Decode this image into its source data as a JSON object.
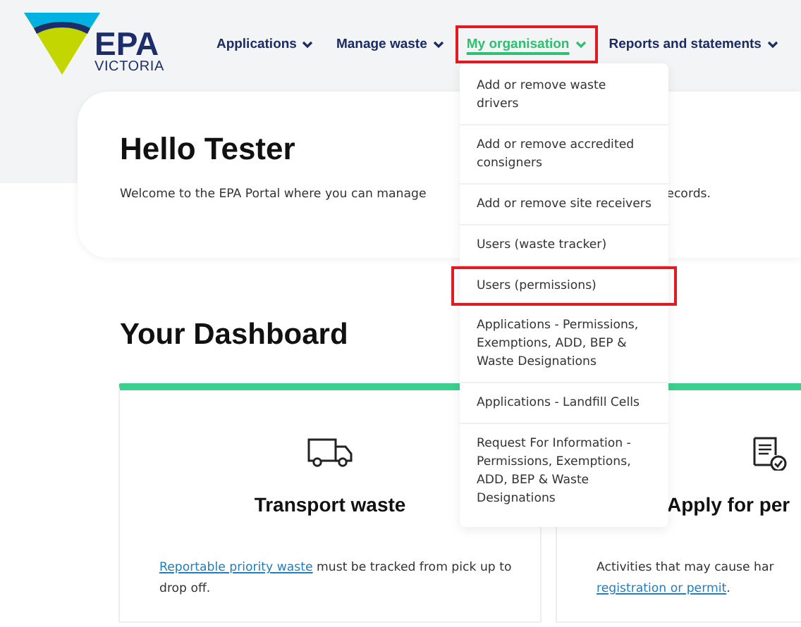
{
  "logo": {
    "name": "EPA",
    "subtitle": "VICTORIA"
  },
  "nav": [
    {
      "label": "Applications",
      "selected": false,
      "highlighted": false
    },
    {
      "label": "Manage waste",
      "selected": false,
      "highlighted": false
    },
    {
      "label": "My organisation",
      "selected": true,
      "highlighted": true
    },
    {
      "label": "Reports and statements",
      "selected": false,
      "highlighted": false
    }
  ],
  "dropdown": {
    "items": [
      {
        "label": "Add or remove waste drivers",
        "highlighted": false
      },
      {
        "label": "Add or remove accredited consigners",
        "highlighted": false
      },
      {
        "label": "Add or remove site receivers",
        "highlighted": false
      },
      {
        "label": "Users (waste tracker)",
        "highlighted": false
      },
      {
        "label": "Users (permissions)",
        "highlighted": true
      },
      {
        "label": "Applications - Permissions, Exemptions, ADD, BEP & Waste Designations",
        "highlighted": false
      },
      {
        "label": "Applications - Landfill Cells",
        "highlighted": false
      },
      {
        "label": "Request For Information - Permissions, Exemptions, ADD, BEP & Waste Designations",
        "highlighted": false
      }
    ]
  },
  "welcome": {
    "title": "Hello Tester",
    "text_left": "Welcome to the EPA Portal where you can manage",
    "text_right": "ecords."
  },
  "dashboard": {
    "title": "Your Dashboard",
    "cards": [
      {
        "title": "Transport waste",
        "link": "Reportable priority waste",
        "text_after": " must be tracked from pick up to drop off."
      },
      {
        "title": "Apply for per",
        "text_before": "Activities that may cause har",
        "link": "registration or permit",
        "text_after": "."
      }
    ]
  }
}
